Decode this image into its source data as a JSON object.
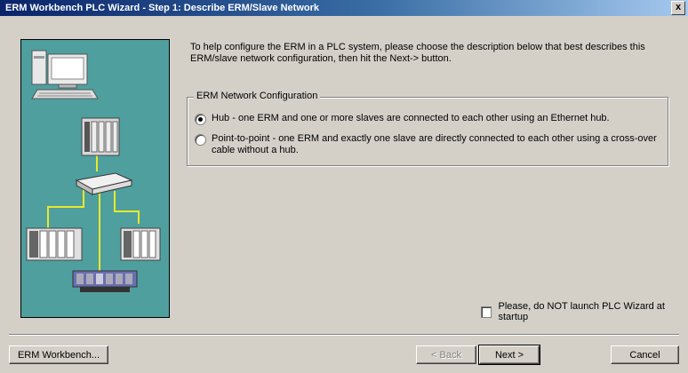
{
  "window": {
    "title": "ERM Workbench PLC Wizard - Step 1: Describe ERM/Slave Network",
    "close_label": "x"
  },
  "main": {
    "instructions": "To help configure the ERM in a PLC system, please choose the description below that best describes this ERM/slave network configuration, then hit the Next-> button.",
    "group_title": "ERM Network Configuration",
    "options": [
      {
        "label": "Hub - one ERM and one or more slaves are connected to each other using an Ethernet hub.",
        "selected": true
      },
      {
        "label": "Point-to-point - one ERM and exactly one slave are directly connected to each other using a cross-over cable without a hub.",
        "selected": false
      }
    ],
    "startup_checkbox": {
      "label": "Please, do NOT launch PLC Wizard at startup",
      "checked": false
    }
  },
  "footer": {
    "workbench_label": "ERM Workbench...",
    "back_label": "< Back",
    "next_label": "Next >",
    "cancel_label": "Cancel"
  },
  "colors": {
    "title_bar": "#0a246a",
    "image_background": "#4f9f9f",
    "cable": "#e8e82a",
    "dialog_face": "#d4d0c8"
  }
}
